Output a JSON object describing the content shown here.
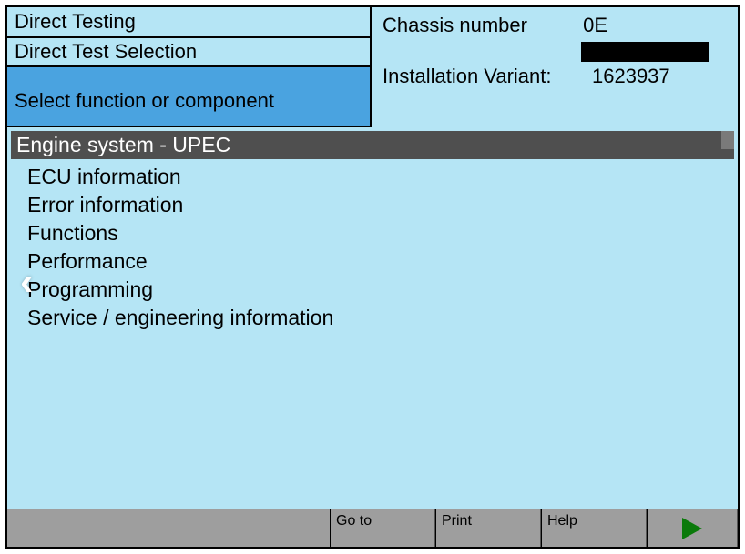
{
  "header": {
    "tabs": {
      "direct_testing": "Direct Testing",
      "direct_test_selection": "Direct Test Selection",
      "select_function": "Select function or component"
    },
    "info": {
      "chassis_label": "Chassis number",
      "chassis_value_prefix": "0E",
      "install_label": "Installation Variant:",
      "install_value": "1623937"
    }
  },
  "main": {
    "section_title": "Engine system - UPEC",
    "items": [
      "ECU information",
      "Error information",
      "Functions",
      "Performance",
      "Programming",
      "Service / engineering information"
    ]
  },
  "footer": {
    "goto": "Go to",
    "print": "Print",
    "help": "Help"
  }
}
